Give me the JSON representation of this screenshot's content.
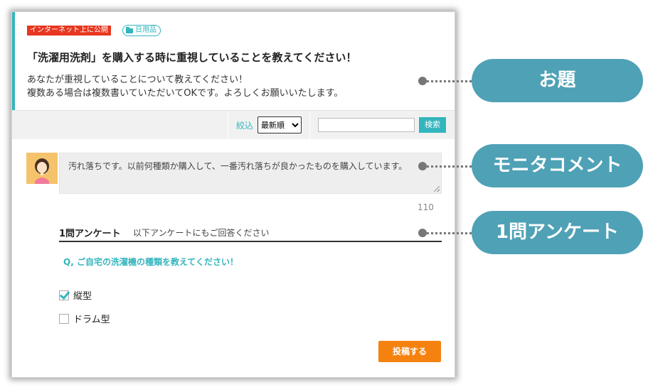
{
  "topic": {
    "public_badge": "インターネット上に公開",
    "category_badge": "日用品",
    "title": "「洗濯用洗剤」を購入する時に重視していることを教えてください！",
    "description_line1": "あなたが重視していることについて教えてください！",
    "description_line2": "複数ある場合は複数書いていただいてOKです。よろしくお願いいたします。"
  },
  "filter": {
    "label": "絞込",
    "sort_selected": "最新順",
    "search_value": "",
    "search_button": "検索"
  },
  "comment": {
    "text": "汚れ落ちです。以前何種類か購入して、一番汚れ落ちが良かったものを購入しています。",
    "char_count": "110"
  },
  "survey": {
    "title": "1問アンケート",
    "subtitle": "以下アンケートにもご回答ください",
    "question": "Q, ご自宅の洗濯機の種類を教えてください！",
    "options": [
      {
        "label": "縦型",
        "checked": true
      },
      {
        "label": "ドラム型",
        "checked": false
      }
    ],
    "submit": "投稿する"
  },
  "callouts": {
    "topic": "お題",
    "comment": "モニタコメント",
    "survey": "1問アンケート"
  },
  "colors": {
    "accent": "#33b5be",
    "callout": "#4fa1b6",
    "submit": "#f5820f",
    "public_badge": "#e8361f"
  }
}
